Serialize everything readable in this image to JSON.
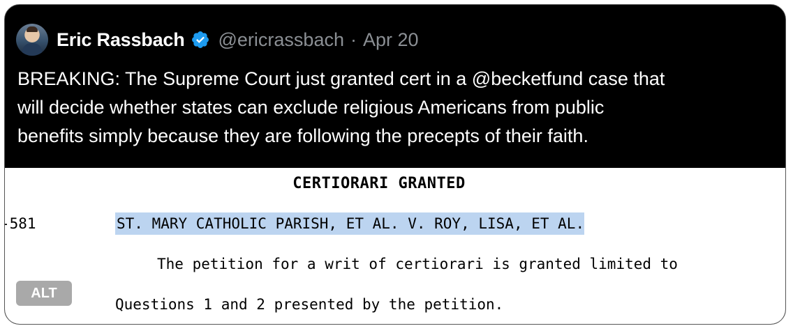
{
  "tweet": {
    "author_name": "Eric Rassbach",
    "handle": "@ericrassbach",
    "separator": "·",
    "date": "Apr 20",
    "verified_icon": "verified-badge-icon",
    "verified_color": "#1d9bf0",
    "text_lines": [
      "BREAKING: The Supreme Court just granted cert in a @becketfund case that",
      "will decide whether states can exclude religious Americans from public",
      "benefits simply because they are following the precepts of their faith."
    ]
  },
  "media": {
    "title": "CERTIORARI GRANTED",
    "docket": "-581",
    "case_name": "ST. MARY CATHOLIC PARISH, ET AL. V. ROY, LISA, ET AL.",
    "body_line_1": "The petition for a writ of certiorari is granted limited to",
    "body_line_2": "Questions 1 and 2 presented by the petition.",
    "highlight_color": "#bcd4f0",
    "alt_label": "ALT"
  }
}
